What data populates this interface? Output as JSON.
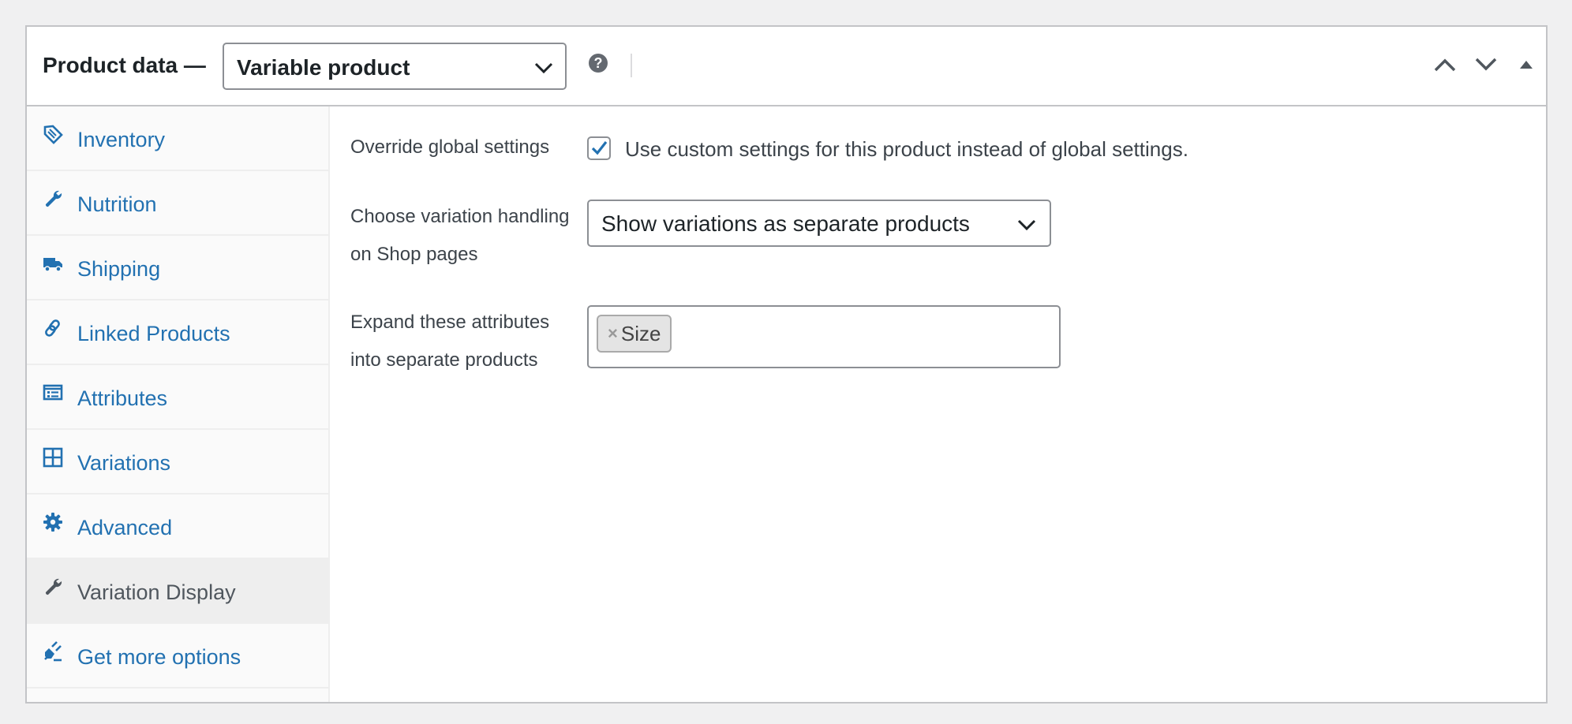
{
  "header": {
    "title": "Product data —",
    "product_type": "Variable product"
  },
  "sidebar": {
    "items": [
      {
        "label": "Inventory",
        "icon": "tag-icon"
      },
      {
        "label": "Nutrition",
        "icon": "wrench-icon"
      },
      {
        "label": "Shipping",
        "icon": "truck-icon"
      },
      {
        "label": "Linked Products",
        "icon": "link-icon"
      },
      {
        "label": "Attributes",
        "icon": "attributes-icon"
      },
      {
        "label": "Variations",
        "icon": "grid-icon"
      },
      {
        "label": "Advanced",
        "icon": "gear-icon"
      },
      {
        "label": "Variation Display",
        "icon": "wrench-icon",
        "active": true
      },
      {
        "label": "Get more options",
        "icon": "plugin-icon"
      }
    ]
  },
  "main": {
    "override": {
      "label": "Override global settings",
      "checkbox_label": "Use custom settings for this product instead of global settings.",
      "checked": true
    },
    "handling": {
      "label_line1": "Choose variation handling",
      "label_line2": "on Shop pages",
      "value": "Show variations as separate products"
    },
    "expand": {
      "label_line1": "Expand these attributes",
      "label_line2": "into separate products",
      "tags": [
        "Size"
      ],
      "remove_glyph": "×"
    }
  },
  "colors": {
    "link": "#2271b1",
    "active_text": "#50575e",
    "checkbox_accent": "#2271b1"
  }
}
